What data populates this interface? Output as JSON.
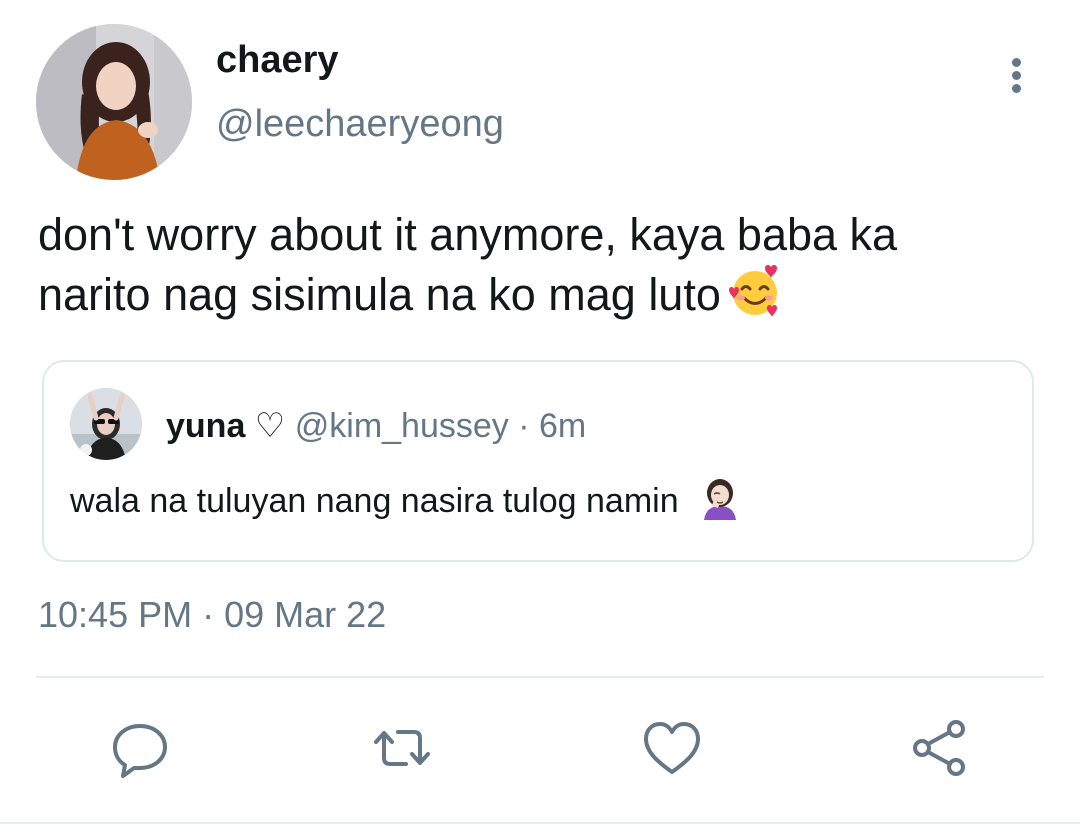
{
  "tweet": {
    "author": {
      "display_name": "chaery",
      "handle": "@leechaeryeong"
    },
    "text_line_1": "don't worry about it anymore, kaya baba ka",
    "text_line_2": "narito nag sisimula na ko mag luto",
    "emoji": "smiling-face-with-hearts",
    "timestamp": "10:45 PM · 09 Mar 22"
  },
  "quoted_tweet": {
    "display_name": "yuna ♡",
    "handle": "@kim_hussey",
    "separator": "·",
    "time": "6m",
    "text": "wala na tuluyan nang nasira tulog namin",
    "emoji": "woman-facepalming"
  },
  "actions": {
    "icons": [
      "reply-icon",
      "retweet-icon",
      "like-icon",
      "share-icon"
    ]
  },
  "colors": {
    "primary_text": "#14171a",
    "secondary_text": "#657786",
    "border": "#e1e8ed",
    "icon": "#657786"
  }
}
